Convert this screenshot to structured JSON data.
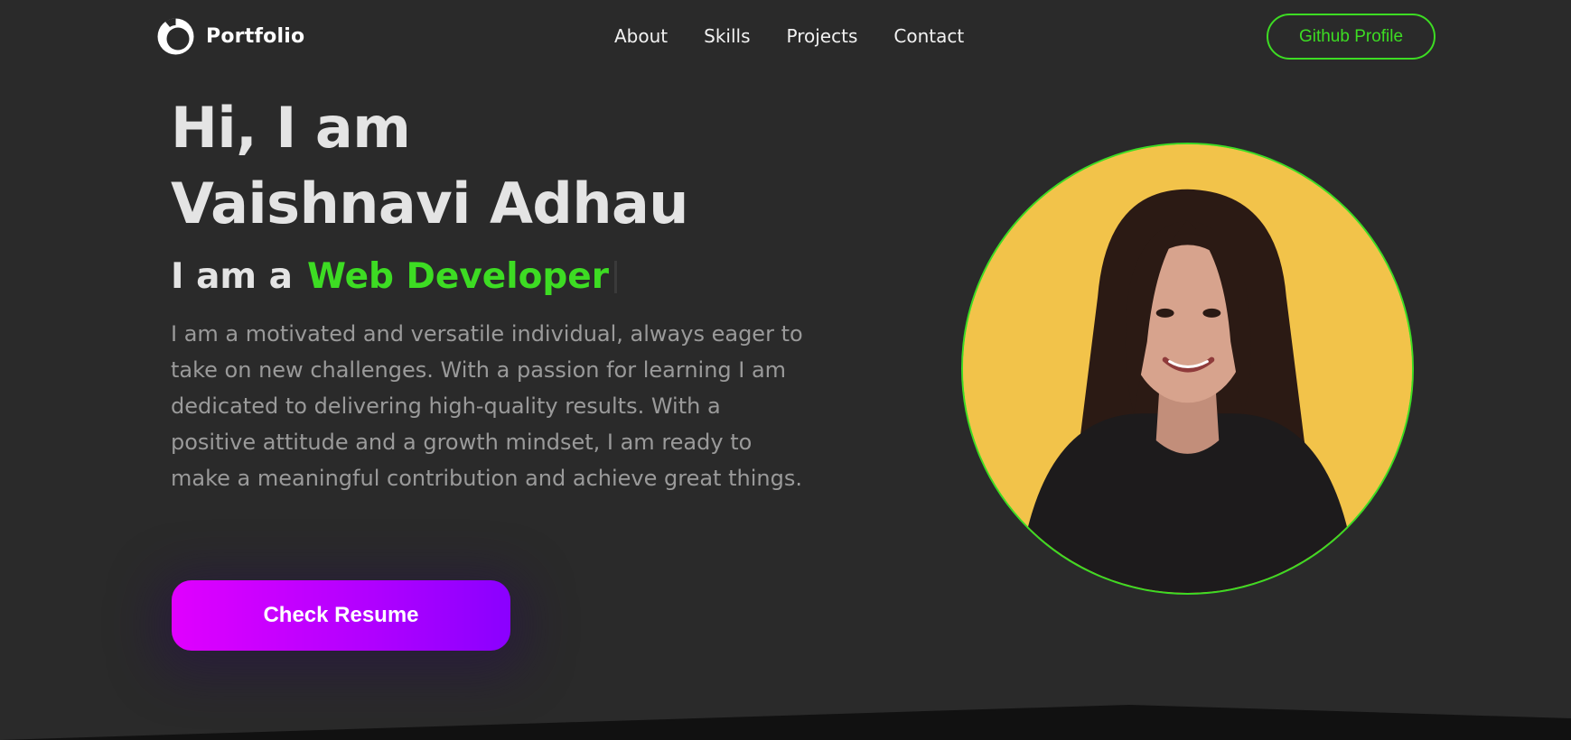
{
  "brand": {
    "name": "Portfolio",
    "logo_icon": "half-circle-logo-icon"
  },
  "nav": {
    "links": [
      "About",
      "Skills",
      "Projects",
      "Contact"
    ],
    "github_label": "Github Profile"
  },
  "hero": {
    "greeting": "Hi, I am",
    "name": "Vaishnavi Adhau",
    "role_prefix": "I am a",
    "role_value": "Web Developer",
    "bio": "I am a motivated and versatile individual, always eager to take on new challenges. With a passion for learning I am dedicated to delivering high-quality results. With a positive attitude and a growth mindset, I am ready to make a meaningful contribution and achieve great things.",
    "resume_label": "Check Resume"
  },
  "colors": {
    "background": "#2a2a2a",
    "accent": "#3ddc23",
    "button_gradient_start": "#e000ff",
    "button_gradient_end": "#8a00ff",
    "photo_background": "#f2c34a"
  }
}
